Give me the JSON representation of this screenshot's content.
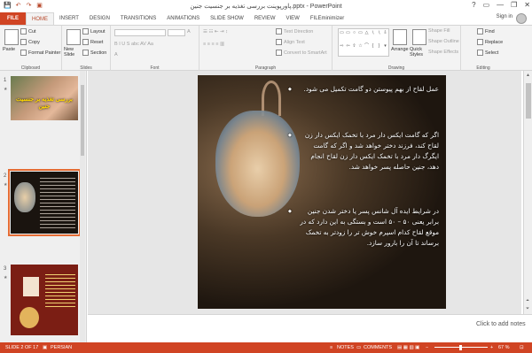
{
  "window": {
    "title": "پاورپوینت بررسی تغذیه بر جنسیت جنین.pptx - PowerPoint",
    "controls": [
      "?",
      "▭",
      "—",
      "❐",
      "✕"
    ]
  },
  "quick_access": [
    "💾",
    "↶",
    "↷",
    "▣"
  ],
  "tabs": [
    "FILE",
    "HOME",
    "INSERT",
    "DESIGN",
    "TRANSITIONS",
    "ANIMATIONS",
    "SLIDE SHOW",
    "REVIEW",
    "VIEW",
    "FILEminimizer"
  ],
  "account": {
    "signin": "Sign in"
  },
  "ribbon": {
    "clipboard": {
      "paste": "Paste",
      "cut": "Cut",
      "copy": "Copy",
      "format_painter": "Format Painter",
      "label": "Clipboard"
    },
    "slides": {
      "new_slide": "New Slide",
      "layout": "Layout",
      "reset": "Reset",
      "section": "Section",
      "label": "Slides"
    },
    "font": {
      "label": "Font"
    },
    "paragraph": {
      "text_direction": "Text Direction",
      "align_text": "Align Text",
      "convert": "Convert to SmartArt",
      "label": "Paragraph"
    },
    "drawing": {
      "arrange": "Arrange",
      "quick_styles": "Quick Styles",
      "shape_fill": "Shape Fill",
      "shape_outline": "Shape Outline",
      "shape_effects": "Shape Effects",
      "label": "Drawing"
    },
    "editing": {
      "find": "Find",
      "replace": "Replace",
      "select": "Select",
      "label": "Editing"
    }
  },
  "thumbnails": {
    "numbers": [
      "1",
      "2",
      "3"
    ],
    "slide1_title": "بررسی تغذیه بر جنسیت جنین"
  },
  "slide": {
    "p1": "عمل لقاح از بهم پیوستن دو گامت تکمیل می شود.",
    "p2": "اگر که گامت ایکس دار مرد با تخمک ایکس دار زن لقاح کند، فرزند دختر خواهد شد و اگر که گامت ایگرگ دار مرد با تخمک ایکس دار زن لقاح انجام دهد، جنین حاصله پسر خواهد شد.",
    "p3": "در شرایط ایده آل شانس پسر یا دختر شدن جنین برابر یعنی ۵۰ – ۵۰ است و بستگی به این دارد که در موقع لقاح کدام اسپرم خوش تر را زودتر به تخمک برساند تا آن را بارور سازد."
  },
  "notes": {
    "placeholder": "Click to add notes"
  },
  "status": {
    "slide": "SLIDE 2 OF 17",
    "language": "PERSIAN",
    "notes": "NOTES",
    "comments": "COMMENTS",
    "zoom": "67 %"
  },
  "colors": {
    "accent": "#d04423",
    "text_yellow": "#ffd800"
  }
}
